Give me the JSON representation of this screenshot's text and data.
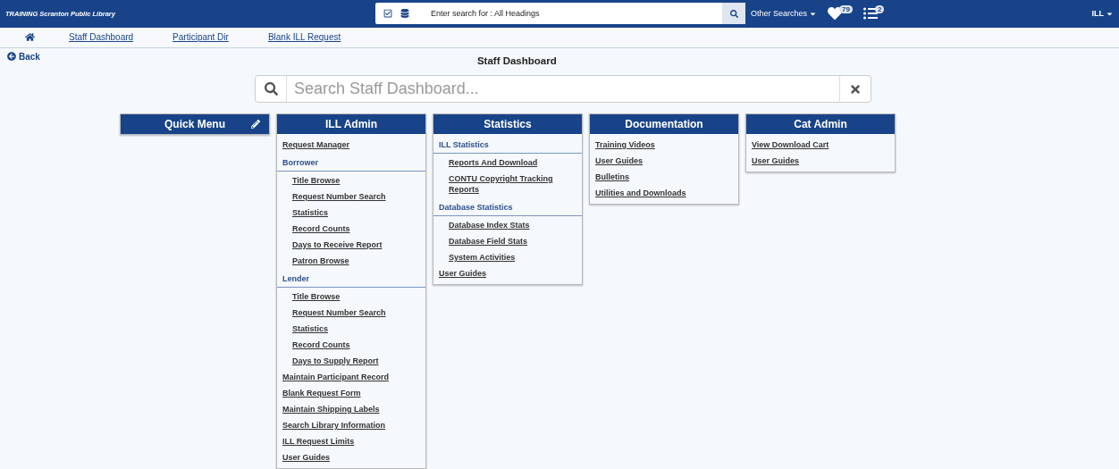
{
  "top_bar": {
    "library": "TRAINING Scranton Public Library",
    "search": {
      "placeholder": "Enter search for : All Headings"
    },
    "other_searches": "Other Searches",
    "favorites_count": "79",
    "list_count": "2",
    "user": "ILL"
  },
  "nav": {
    "links": [
      "Staff Dashboard",
      "Participant Dir",
      "Blank ILL Request"
    ]
  },
  "back": "Back",
  "title": "Staff Dashboard",
  "dashboard_search": {
    "placeholder": "Search Staff Dashboard..."
  },
  "panels": [
    {
      "title": "Quick Menu",
      "editable": true
    },
    {
      "title": "ILL Admin",
      "editable": false,
      "items": [
        {
          "kind": "link",
          "label": "Request Manager"
        },
        {
          "kind": "section",
          "label": "Borrower"
        },
        {
          "kind": "sublink",
          "label": "Title Browse"
        },
        {
          "kind": "sublink",
          "label": "Request Number Search"
        },
        {
          "kind": "sublink",
          "label": "Statistics"
        },
        {
          "kind": "sublink",
          "label": "Record Counts"
        },
        {
          "kind": "sublink",
          "label": "Days to Receive Report"
        },
        {
          "kind": "sublink",
          "label": "Patron Browse"
        },
        {
          "kind": "section",
          "label": "Lender"
        },
        {
          "kind": "sublink",
          "label": "Title Browse"
        },
        {
          "kind": "sublink",
          "label": "Request Number Search"
        },
        {
          "kind": "sublink",
          "label": "Statistics"
        },
        {
          "kind": "sublink",
          "label": "Record Counts"
        },
        {
          "kind": "sublink",
          "label": "Days to Supply Report"
        },
        {
          "kind": "link",
          "label": "Maintain Participant Record"
        },
        {
          "kind": "link",
          "label": "Blank Request Form"
        },
        {
          "kind": "link",
          "label": "Maintain Shipping Labels"
        },
        {
          "kind": "link",
          "label": "Search Library Information"
        },
        {
          "kind": "link",
          "label": "ILL Request Limits"
        },
        {
          "kind": "link",
          "label": "User Guides"
        }
      ]
    },
    {
      "title": "Statistics",
      "editable": false,
      "items": [
        {
          "kind": "section",
          "label": "ILL Statistics"
        },
        {
          "kind": "sublink",
          "label": "Reports And Download"
        },
        {
          "kind": "sublink",
          "label": "CONTU Copyright Tracking Reports"
        },
        {
          "kind": "section",
          "label": "Database Statistics"
        },
        {
          "kind": "sublink",
          "label": "Database Index Stats"
        },
        {
          "kind": "sublink",
          "label": "Database Field Stats"
        },
        {
          "kind": "sublink",
          "label": "System Activities"
        },
        {
          "kind": "link",
          "label": "User Guides"
        }
      ]
    },
    {
      "title": "Documentation",
      "editable": false,
      "items": [
        {
          "kind": "link",
          "label": "Training Videos"
        },
        {
          "kind": "link",
          "label": "User Guides"
        },
        {
          "kind": "link",
          "label": "Bulletins"
        },
        {
          "kind": "link",
          "label": "Utilities and Downloads"
        }
      ]
    },
    {
      "title": "Cat Admin",
      "editable": false,
      "items": [
        {
          "kind": "link",
          "label": "View Download Cart"
        },
        {
          "kind": "link",
          "label": "User Guides"
        }
      ]
    }
  ]
}
